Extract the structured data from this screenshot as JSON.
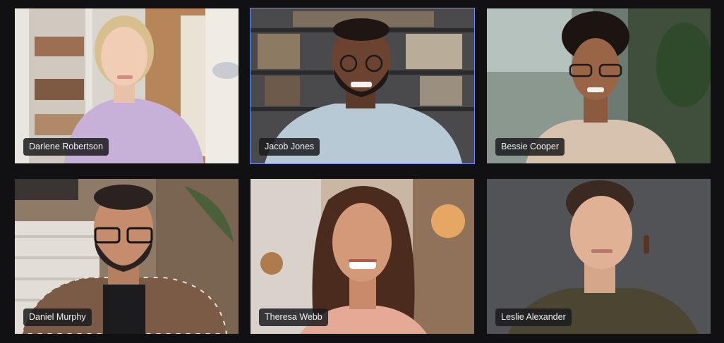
{
  "call": {
    "active_speaker": "Jacob Jones",
    "participants": [
      {
        "name": "Darlene Robertson",
        "accent": "#cdb6dc"
      },
      {
        "name": "Jacob Jones",
        "accent": "#c9d6df"
      },
      {
        "name": "Bessie Cooper",
        "accent": "#d9c6b3"
      },
      {
        "name": "Daniel Murphy",
        "accent": "#7a5540"
      },
      {
        "name": "Theresa Webb",
        "accent": "#e8b2a5"
      },
      {
        "name": "Leslie Alexander",
        "accent": "#4a4632"
      }
    ]
  },
  "colors": {
    "background": "#111113",
    "active_outline": "#6f86ff",
    "badge_bg": "#1c1c20",
    "badge_text": "#f3f3f5"
  }
}
